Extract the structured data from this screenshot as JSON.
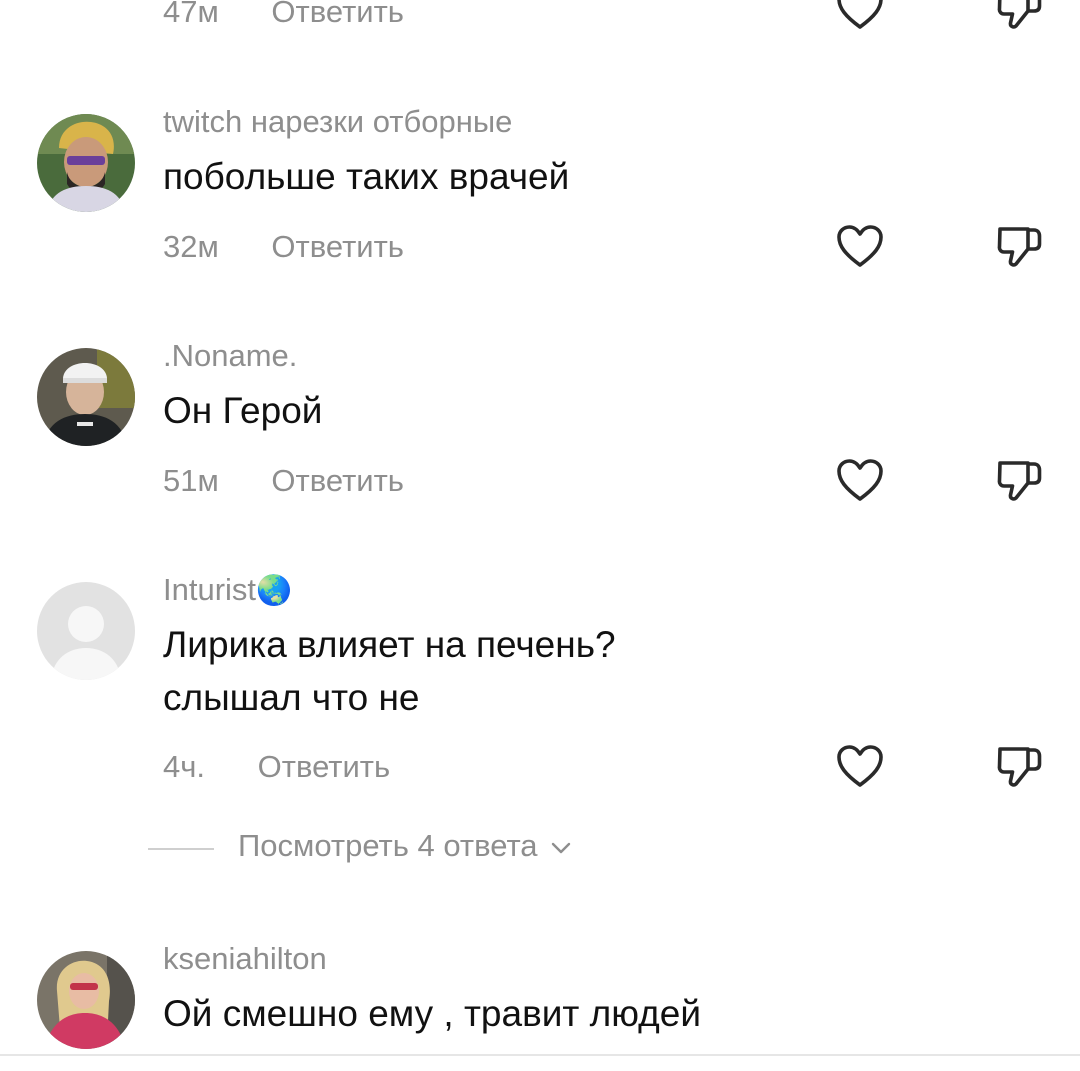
{
  "reply_label": "Ответить",
  "comments": [
    {
      "time": "47м"
    },
    {
      "username": "twitch нарезки отборные",
      "text": "побольше таких врачей",
      "time": "32м"
    },
    {
      "username": ".Noname.",
      "text": "Он Герой",
      "time": "51м"
    },
    {
      "username": "Inturist",
      "username_emoji": "🌏",
      "text_lines": [
        "Лирика влияет на печень?",
        "слышал что не"
      ],
      "time": "4ч."
    },
    {
      "username": "kseniahilton",
      "text": "Ой смешно ему , травит людей"
    }
  ],
  "view_replies": {
    "label": "Посмотреть 4 ответа"
  },
  "icons": {
    "like": "heart-outline-icon",
    "dislike": "thumbs-down-icon",
    "expand": "chevron-down-icon",
    "placeholder_avatar": "user-silhouette-icon"
  },
  "colors": {
    "text": "#111111",
    "secondary": "#8e8e8e",
    "icon": "#2a2a2a"
  }
}
